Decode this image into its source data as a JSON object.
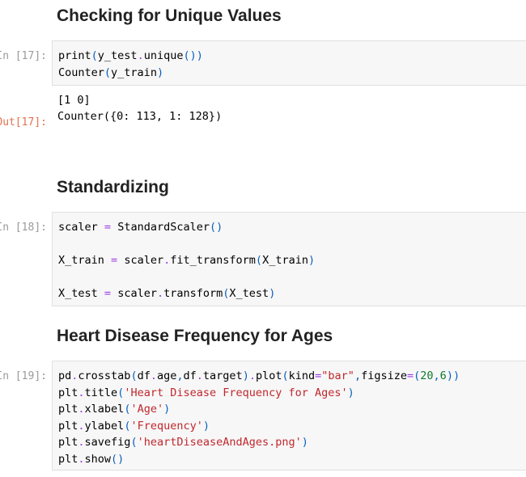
{
  "sections": [
    {
      "heading": "Checking for Unique Values"
    },
    {
      "heading": "Standardizing"
    },
    {
      "heading": "Heart Disease Frequency for Ages"
    }
  ],
  "cells": [
    {
      "in_prompt": "In [17]:",
      "out_prompt": "Out[17]:",
      "output_lines": [
        "[1 0]",
        "Counter({0: 113, 1: 128})"
      ]
    },
    {
      "in_prompt": "In [18]:"
    },
    {
      "in_prompt": "In [19]:"
    }
  ]
}
